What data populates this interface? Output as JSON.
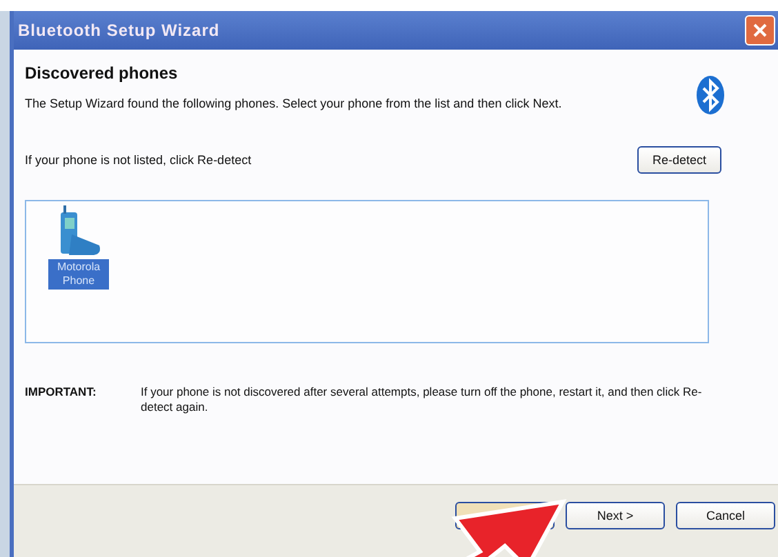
{
  "window": {
    "title": "Bluetooth Setup Wizard"
  },
  "header": {
    "title": "Discovered phones",
    "description": "The Setup Wizard found the following phones. Select your phone from the list and then click Next."
  },
  "redetect_hint": "If your phone is not listed, click Re-detect",
  "redetect_button": "Re-detect",
  "devices": [
    {
      "label": "Motorola Phone",
      "selected": true
    }
  ],
  "important": {
    "label": "IMPORTANT:",
    "text": "If your phone is not discovered after several attempts, please turn off the phone, restart it, and then click Re-detect again."
  },
  "buttons": [
    {
      "kind": "back"
    },
    {
      "kind": "next",
      "label": "Next >"
    },
    {
      "kind": "cancel",
      "label": "Cancel"
    }
  ]
}
